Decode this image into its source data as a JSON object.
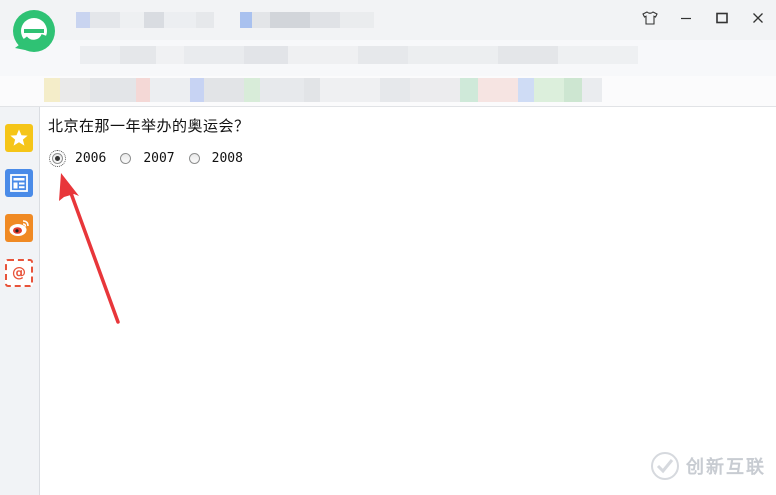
{
  "window": {
    "controls": {
      "skin_icon": "tshirt-icon",
      "minimize_label": "—",
      "maximize_label": "☐",
      "close_label": "✕"
    }
  },
  "sidebar": {
    "items": [
      {
        "name": "favorites",
        "icon": "star-icon",
        "color": "#f5c518"
      },
      {
        "name": "reader",
        "icon": "list-icon",
        "color": "#4a8be8"
      },
      {
        "name": "weibo",
        "icon": "weibo-icon",
        "color": "#f08a24"
      },
      {
        "name": "mail",
        "icon": "mail-icon",
        "color": "#e8533a",
        "glyph": "@"
      }
    ]
  },
  "content": {
    "question": "北京在那一年举办的奥运会？",
    "options": [
      {
        "label": "2006",
        "checked": true
      },
      {
        "label": "2007",
        "checked": false
      },
      {
        "label": "2008",
        "checked": false
      }
    ]
  },
  "watermark": {
    "text": "创新互联"
  },
  "colors": {
    "brand_green": "#2fc274",
    "arrow_red": "#e8363a"
  }
}
